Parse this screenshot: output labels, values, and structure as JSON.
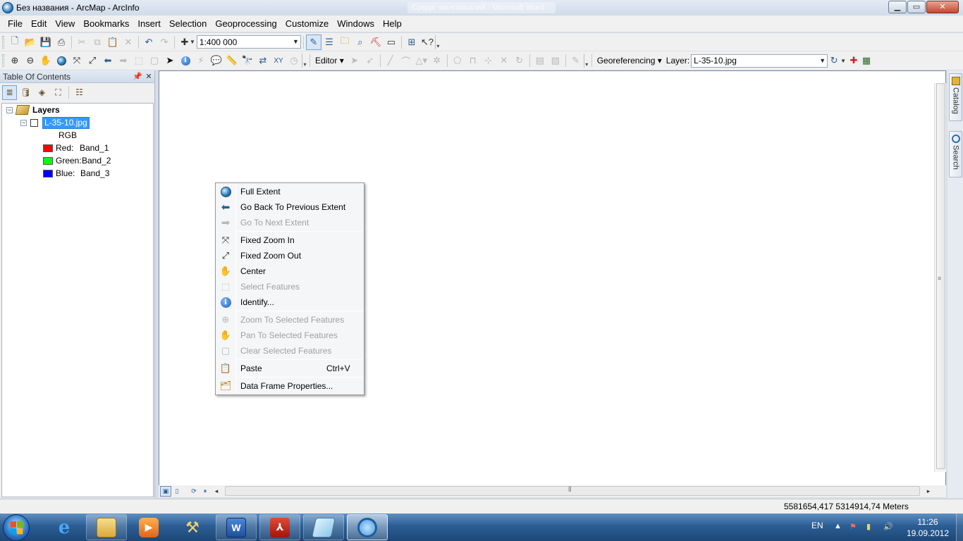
{
  "window": {
    "title": "Без названия - ArcMap - ArcInfo",
    "background_window_title": "Среда: мангавьилий - Microsoft Word"
  },
  "menu": [
    "File",
    "Edit",
    "View",
    "Bookmarks",
    "Insert",
    "Selection",
    "Geoprocessing",
    "Customize",
    "Windows",
    "Help"
  ],
  "toolbar": {
    "scale": "1:400 000",
    "editor_label": "Editor",
    "georeferencing_label": "Georeferencing",
    "layer_label": "Layer:",
    "layer_value": "L-35-10.jpg"
  },
  "toc": {
    "title": "Table Of Contents",
    "root": "Layers",
    "layer": "L-35-10.jpg",
    "render": "RGB",
    "bands": [
      {
        "label": "Red:",
        "band": "Band_1",
        "color": "#ff0000"
      },
      {
        "label": "Green:",
        "band": "Band_2",
        "color": "#00ff00"
      },
      {
        "label": "Blue:",
        "band": "Band_3",
        "color": "#0000ff"
      }
    ]
  },
  "context_menu": {
    "items": [
      {
        "label": "Full Extent",
        "enabled": true,
        "icon": "globe-icon"
      },
      {
        "label": "Go Back To Previous Extent",
        "enabled": true,
        "icon": "back-arrow-icon"
      },
      {
        "label": "Go To Next Extent",
        "enabled": false,
        "icon": "forward-arrow-icon"
      },
      {
        "label": "Fixed Zoom In",
        "enabled": true,
        "icon": "fixed-zoom-in-icon"
      },
      {
        "label": "Fixed Zoom Out",
        "enabled": true,
        "icon": "fixed-zoom-out-icon"
      },
      {
        "label": "Center",
        "enabled": true,
        "icon": "hand-icon"
      },
      {
        "label": "Select Features",
        "enabled": false,
        "icon": "select-features-icon"
      },
      {
        "label": "Identify...",
        "enabled": true,
        "icon": "identify-icon"
      },
      {
        "label": "Zoom To Selected Features",
        "enabled": false,
        "icon": "zoom-selected-icon"
      },
      {
        "label": "Pan To Selected Features",
        "enabled": false,
        "icon": "pan-selected-icon"
      },
      {
        "label": "Clear Selected Features",
        "enabled": false,
        "icon": "clear-selection-icon"
      },
      {
        "label": "Paste",
        "shortcut": "Ctrl+V",
        "enabled": true,
        "icon": "paste-icon"
      },
      {
        "label": "Data Frame Properties...",
        "enabled": true,
        "icon": "data-frame-properties-icon"
      }
    ]
  },
  "side_panels": {
    "catalog": "Catalog",
    "search": "Search"
  },
  "status": {
    "coordinates": "5581654,417  5314914,74 Meters"
  },
  "taskbar": {
    "language": "EN",
    "time": "11:26",
    "date": "19.09.2012"
  }
}
